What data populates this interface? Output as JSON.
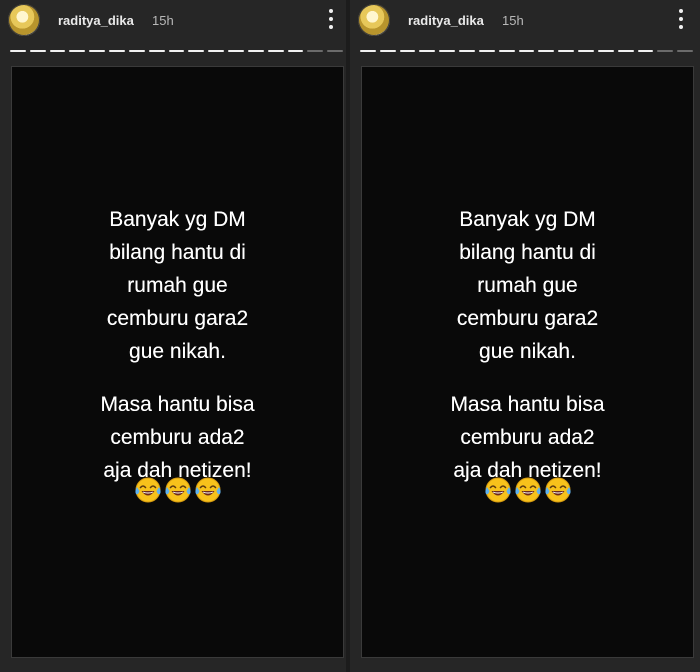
{
  "stories": [
    {
      "username": "raditya_dika",
      "time": "15h",
      "progress": {
        "segments": 17,
        "viewed": 15
      },
      "caption_paragraphs": [
        [
          "Banyak yg DM",
          "bilang hantu di",
          "rumah gue",
          "cemburu gara2",
          "gue nikah."
        ],
        [
          "Masa hantu bisa",
          "cemburu ada2",
          "aja dah netizen!"
        ]
      ],
      "emoji": {
        "name": "face-with-tears-of-joy",
        "count": 3
      }
    },
    {
      "username": "raditya_dika",
      "time": "15h",
      "progress": {
        "segments": 17,
        "viewed": 15
      },
      "caption_paragraphs": [
        [
          "Banyak yg DM",
          "bilang hantu di",
          "rumah gue",
          "cemburu gara2",
          "gue nikah."
        ],
        [
          "Masa hantu bisa",
          "cemburu ada2",
          "aja dah netizen!"
        ]
      ],
      "emoji": {
        "name": "face-with-tears-of-joy",
        "count": 3
      }
    }
  ],
  "colors": {
    "background": "#262626",
    "story_bg": "#090909",
    "text": "#ffffff",
    "progress_viewed": "#f2f2f2",
    "progress_unviewed": "#6b6b6b"
  }
}
